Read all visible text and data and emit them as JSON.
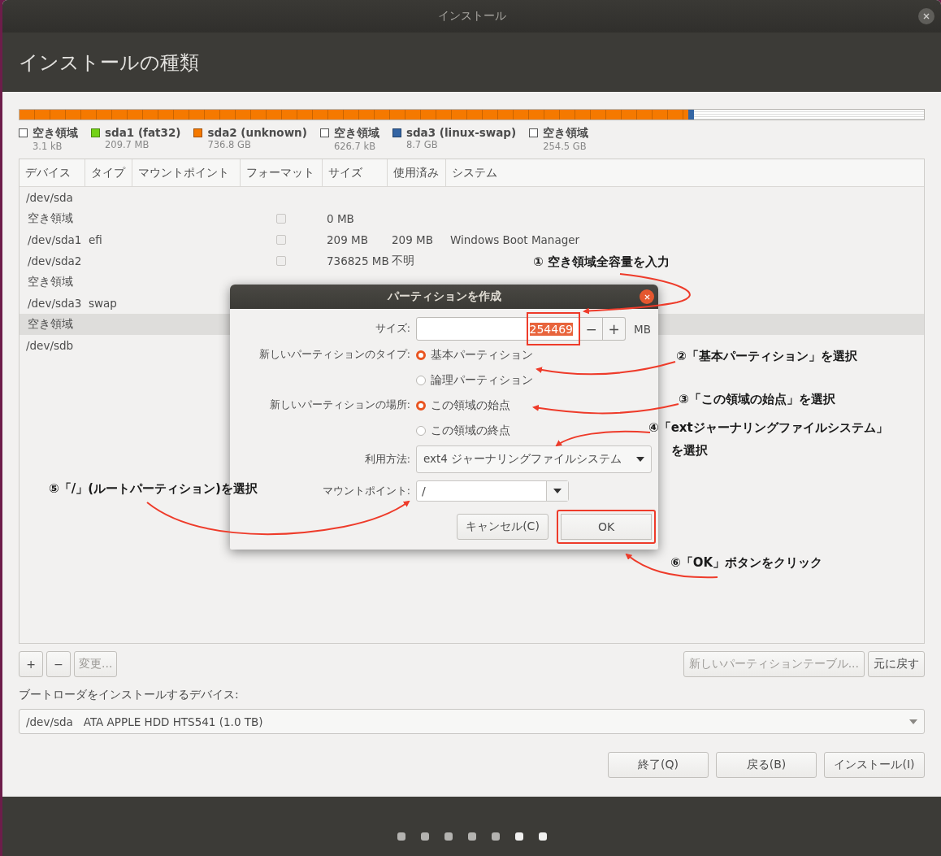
{
  "window": {
    "title": "インストール"
  },
  "header": {
    "title": "インストールの種類"
  },
  "partition_bar": [
    {
      "label": "空き領域",
      "size": "3.1 kB",
      "color": "#ffffff",
      "level": 0.0001
    },
    {
      "label": "sda1 (fat32)",
      "size": "209.7 MB",
      "color": "#73d216",
      "level": 0.0002
    },
    {
      "label": "sda2 (unknown)",
      "size": "736.8 GB",
      "color": "#f57900",
      "level": 0.739
    },
    {
      "label": "空き領域",
      "size": "626.7 kB",
      "color": "#ffffff",
      "level": 0.0001
    },
    {
      "label": "sda3 (linux-swap)",
      "size": "8.7 GB",
      "color": "#3465a4",
      "level": 0.007
    },
    {
      "label": "空き領域",
      "size": "254.5 GB",
      "color": "#ffffff",
      "level": 0.254
    }
  ],
  "table": {
    "columns": [
      "デバイス",
      "タイプ",
      "マウントポイント",
      "フォーマット",
      "サイズ",
      "使用済み",
      "システム"
    ],
    "rows": [
      {
        "device": "/dev/sda",
        "selected": false,
        "children": [
          {
            "device": "空き領域",
            "format": false,
            "size": "0 MB",
            "selected": false
          },
          {
            "device": "/dev/sda1",
            "type": "efi",
            "format": false,
            "size": "209 MB",
            "used": "209 MB",
            "system": "Windows Boot Manager",
            "selected": false
          },
          {
            "device": "/dev/sda2",
            "format": false,
            "size": "736825 MB",
            "used": "不明",
            "selected": false
          },
          {
            "device": "空き領域",
            "selected": false
          },
          {
            "device": "/dev/sda3",
            "type": "swap",
            "selected": false
          },
          {
            "device": "空き領域",
            "selected": true
          }
        ]
      },
      {
        "device": "/dev/sdb",
        "selected": false
      }
    ]
  },
  "table_toolbar": {
    "buttons": [
      {
        "label": "+",
        "disabled": false
      },
      {
        "label": "−",
        "disabled": false
      },
      {
        "label": "変更...",
        "disabled": true
      }
    ],
    "right_buttons": [
      {
        "label": "新しいパーティションテーブル...",
        "disabled": true
      },
      {
        "label": "元に戻す",
        "disabled": false
      }
    ]
  },
  "bootloader": {
    "label": "ブートローダをインストールするデバイス:",
    "value": "/dev/sda   ATA APPLE HDD HTS541 (1.0 TB)"
  },
  "buttons": [
    "終了(Q)",
    "戻る(B)",
    "インストール(I)"
  ],
  "steps": [
    {
      "highlighted": false
    },
    {
      "highlighted": false
    },
    {
      "highlighted": false
    },
    {
      "highlighted": false
    },
    {
      "highlighted": false
    },
    {
      "highlighted": true
    },
    {
      "highlighted": true
    }
  ],
  "dialog": {
    "title": "パーティションを作成",
    "size": {
      "label": "サイズ:",
      "value": "254469",
      "minus": "−",
      "plus": "+",
      "unit": "MB"
    },
    "type": {
      "label": "新しいパーティションのタイプ:",
      "options": [
        {
          "label": "基本パーティション",
          "selected": true
        },
        {
          "label": "論理パーティション",
          "selected": false
        }
      ]
    },
    "location": {
      "label": "新しいパーティションの場所:",
      "options": [
        {
          "label": "この領域の始点",
          "selected": true
        },
        {
          "label": "この領域の終点",
          "selected": false
        }
      ]
    },
    "use_as": {
      "label": "利用方法:",
      "value": "ext4 ジャーナリングファイルシステム"
    },
    "mount_point": {
      "label": "マウントポイント:",
      "value": "/"
    },
    "buttons": [
      {
        "label": "キャンセル(C)",
        "highlighted": false
      },
      {
        "label": "OK",
        "highlighted": true
      }
    ]
  },
  "annotations": [
    {
      "lines": [
        "① 空き領域全容量を入力"
      ]
    },
    {
      "lines": [
        "②「基本パーティション」を選択"
      ]
    },
    {
      "lines": [
        "③「この領域の始点」を選択"
      ]
    },
    {
      "lines": [
        "④「extジャーナリングファイルシステム」",
        "を選択"
      ]
    },
    {
      "lines": [
        "⑤「/」(ルートパーティション)を選択"
      ]
    },
    {
      "lines": [
        "⑥「OK」ボタンをクリック"
      ]
    }
  ]
}
